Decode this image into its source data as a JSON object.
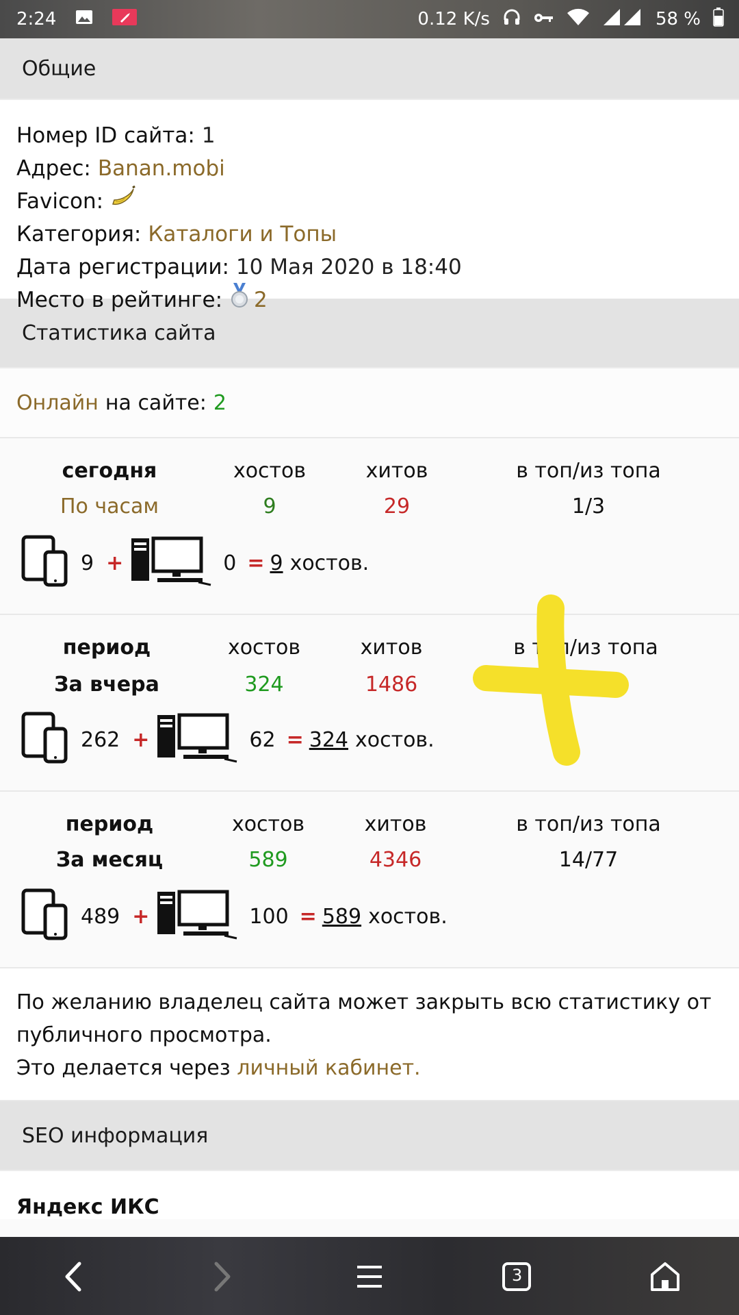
{
  "status_bar": {
    "time": "2:24",
    "speed": "0.12 K/s",
    "battery": "58 %",
    "icons": [
      "image-icon",
      "rocket-icon",
      "headphones-icon",
      "key-icon",
      "wifi-icon",
      "signal-icon",
      "battery-icon"
    ]
  },
  "general": {
    "title": "Общие",
    "id_label": "Номер ID сайта:",
    "id_value": "1",
    "address_label": "Адрес:",
    "address_value": "Banan.mobi",
    "favicon_label": "Favicon:",
    "favicon_icon": "banana-icon",
    "category_label": "Категория:",
    "category_value": "Каталоги и Топы",
    "reg_label": "Дата регистрации:",
    "reg_value": "10 Мая 2020 в 18:40",
    "rank_label": "Место в рейтинге:",
    "rank_icon": "silver-medal-icon",
    "rank_value": "2"
  },
  "stats": {
    "title": "Статистика сайта",
    "online_link": "Онлайн",
    "online_text": "на сайте:",
    "online_value": "2",
    "col_hosts": "хостов",
    "col_hits": "хитов",
    "col_top": "в топ/из топа",
    "hosts_suffix": "хостов.",
    "blocks": [
      {
        "period_label": "сегодня",
        "period_name": "По часам",
        "hosts": "9",
        "hits": "29",
        "top": "1/3",
        "mobile": "9",
        "desktop": "0",
        "total": "9"
      },
      {
        "period_label": "период",
        "period_name": "За вчера",
        "hosts": "324",
        "hits": "1486",
        "top": "",
        "mobile": "262",
        "desktop": "62",
        "total": "324"
      },
      {
        "period_label": "период",
        "period_name": "За месяц",
        "hosts": "589",
        "hits": "4346",
        "top": "14/77",
        "mobile": "489",
        "desktop": "100",
        "total": "589"
      }
    ],
    "note_line1": "По желанию владелец сайта может закрыть всю статистику от",
    "note_line2": "публичного просмотра.",
    "note_line3": "Это делается через",
    "note_link": "личный кабинет."
  },
  "seo": {
    "title": "SEO информация",
    "yandex_label": "Яндекс ИКС"
  },
  "nav": {
    "tabs_count": "3",
    "icons": [
      "back-icon",
      "forward-icon",
      "menu-icon",
      "tabs-icon",
      "home-icon"
    ]
  },
  "colors": {
    "link": "#8b6a2a",
    "green": "#1f9a1f",
    "red": "#c62828",
    "annotation": "#f5e02a"
  }
}
